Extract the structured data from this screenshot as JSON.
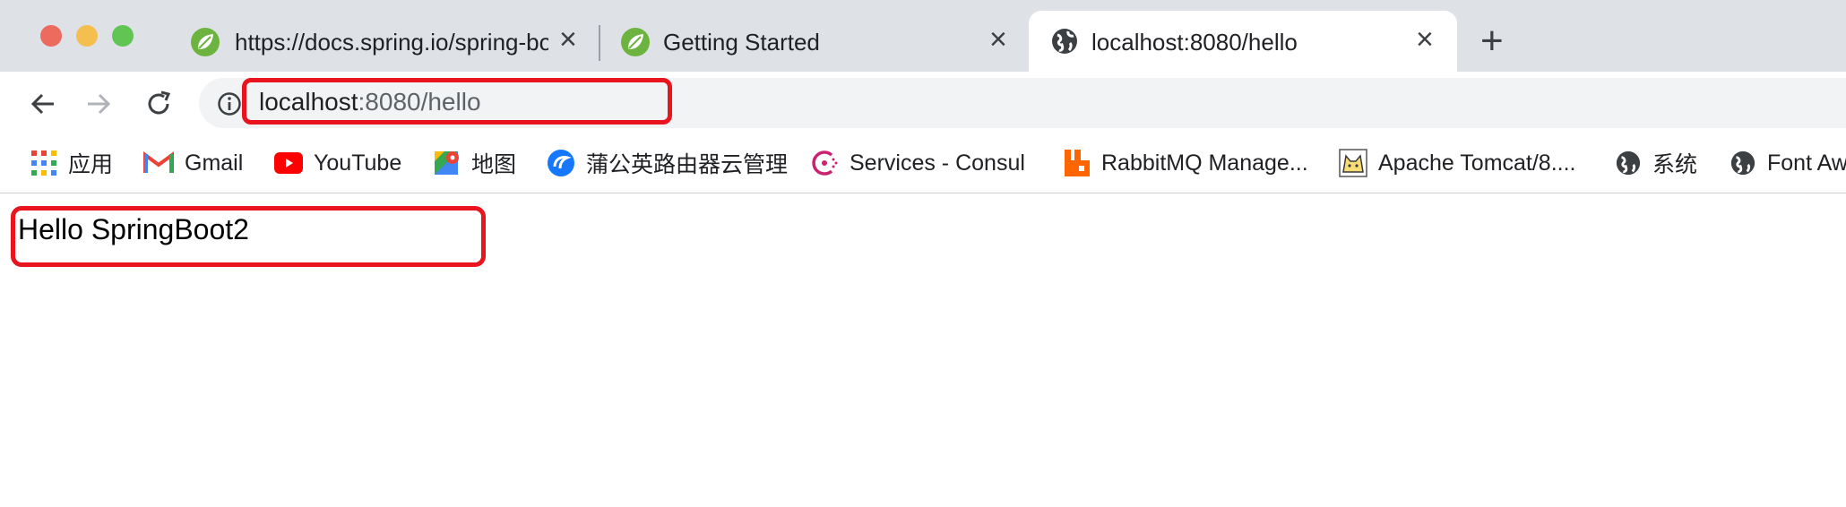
{
  "window": {
    "traffic_lights": {
      "close": "#ed6a5e",
      "minimize": "#f5bf4f",
      "maximize": "#61c554"
    }
  },
  "tabs": [
    {
      "title": "https://docs.spring.io/spring-boot",
      "icon": "spring-leaf-icon",
      "active": false
    },
    {
      "title": "Getting Started",
      "icon": "spring-leaf-icon",
      "active": false
    },
    {
      "title": "localhost:8080/hello",
      "icon": "globe-icon",
      "active": true
    }
  ],
  "toolbar": {
    "url_host": "localhost",
    "url_rest": ":8080/hello"
  },
  "bookmarks": [
    {
      "label": "应用",
      "icon": "apps-grid-icon"
    },
    {
      "label": "Gmail",
      "icon": "gmail-icon"
    },
    {
      "label": "YouTube",
      "icon": "youtube-icon"
    },
    {
      "label": "地图",
      "icon": "maps-icon"
    },
    {
      "label": "蒲公英路由器云管理",
      "icon": "pgy-icon"
    },
    {
      "label": "Services - Consul",
      "icon": "consul-icon"
    },
    {
      "label": "RabbitMQ Manage...",
      "icon": "rabbitmq-icon"
    },
    {
      "label": "Apache Tomcat/8....",
      "icon": "tomcat-icon"
    },
    {
      "label": "系统",
      "icon": "globe-icon"
    },
    {
      "label": "Font Aw",
      "icon": "globe-icon"
    }
  ],
  "page": {
    "content_text": "Hello SpringBoot2"
  },
  "colors": {
    "highlight": "#e8141e",
    "spring_green": "#6db33f",
    "tab_strip": "#dee1e6",
    "omnibox": "#f1f3f4"
  }
}
